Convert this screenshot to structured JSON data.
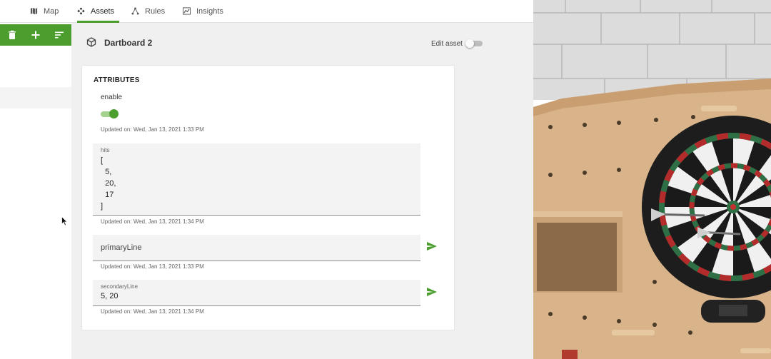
{
  "nav": {
    "tabs": [
      {
        "label": "Map",
        "icon": "map-icon"
      },
      {
        "label": "Assets",
        "icon": "assets-icon",
        "active": true
      },
      {
        "label": "Rules",
        "icon": "rules-icon"
      },
      {
        "label": "Insights",
        "icon": "insights-icon"
      }
    ]
  },
  "toolbar": {
    "accent": "#4b9e2d",
    "buttons": [
      "delete-icon",
      "add-icon",
      "sort-icon"
    ]
  },
  "asset": {
    "title": "Dartboard 2",
    "edit_label": "Edit asset",
    "edit_on": false
  },
  "attributes": {
    "title": "ATTRIBUTES",
    "enable": {
      "label": "enable",
      "value": true,
      "updated": "Updated on: Wed, Jan 13, 2021 1:33 PM"
    },
    "hits": {
      "label": "hits",
      "lines": [
        "[",
        "  5,",
        "  20,",
        "  17",
        "]"
      ],
      "updated": "Updated on: Wed, Jan 13, 2021 1:34 PM"
    },
    "primaryLine": {
      "placeholder": "primaryLine",
      "updated": "Updated on: Wed, Jan 13, 2021 1:33 PM"
    },
    "secondaryLine": {
      "label": "secondaryLine",
      "value": "5, 20",
      "updated": "Updated on: Wed, Jan 13, 2021 1:34 PM"
    }
  }
}
